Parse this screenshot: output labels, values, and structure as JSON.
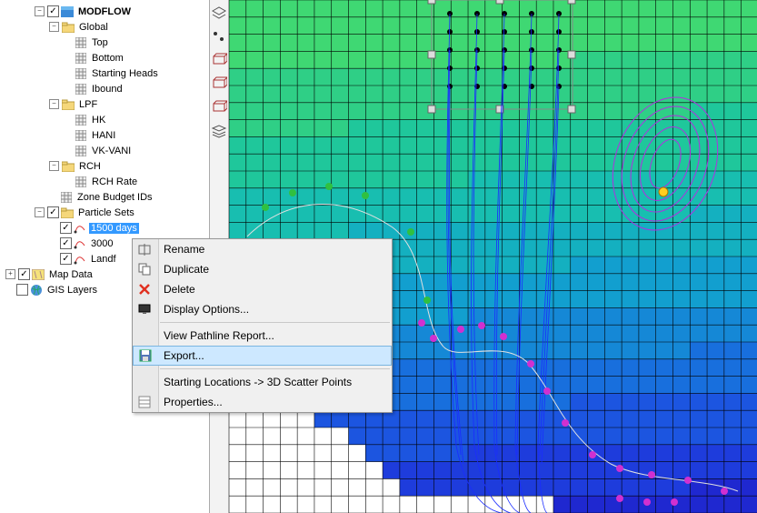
{
  "tree": {
    "modflow": "MODFLOW",
    "global": "Global",
    "top": "Top",
    "bottom": "Bottom",
    "starting_heads": "Starting Heads",
    "ibound": "Ibound",
    "lpf": "LPF",
    "hk": "HK",
    "hani": "HANI",
    "vkvani": "VK-VANI",
    "rch": "RCH",
    "rch_rate": "RCH Rate",
    "zone_budget": "Zone Budget IDs",
    "particle_sets": "Particle Sets",
    "p_1500": "1500 days",
    "p_3000": "3000",
    "p_landf": "Landf",
    "map_data": "Map Data",
    "gis_layers": "GIS Layers"
  },
  "context_menu": {
    "rename": "Rename",
    "duplicate": "Duplicate",
    "delete": "Delete",
    "display_options": "Display Options...",
    "view_pathline": "View Pathline Report...",
    "export": "Export...",
    "starting_locations": "Starting Locations -> 3D Scatter Points",
    "properties": "Properties..."
  },
  "colors": {
    "selection": "#3399ff",
    "menu_hover": "#cde8ff",
    "grid_major": "#000000"
  }
}
